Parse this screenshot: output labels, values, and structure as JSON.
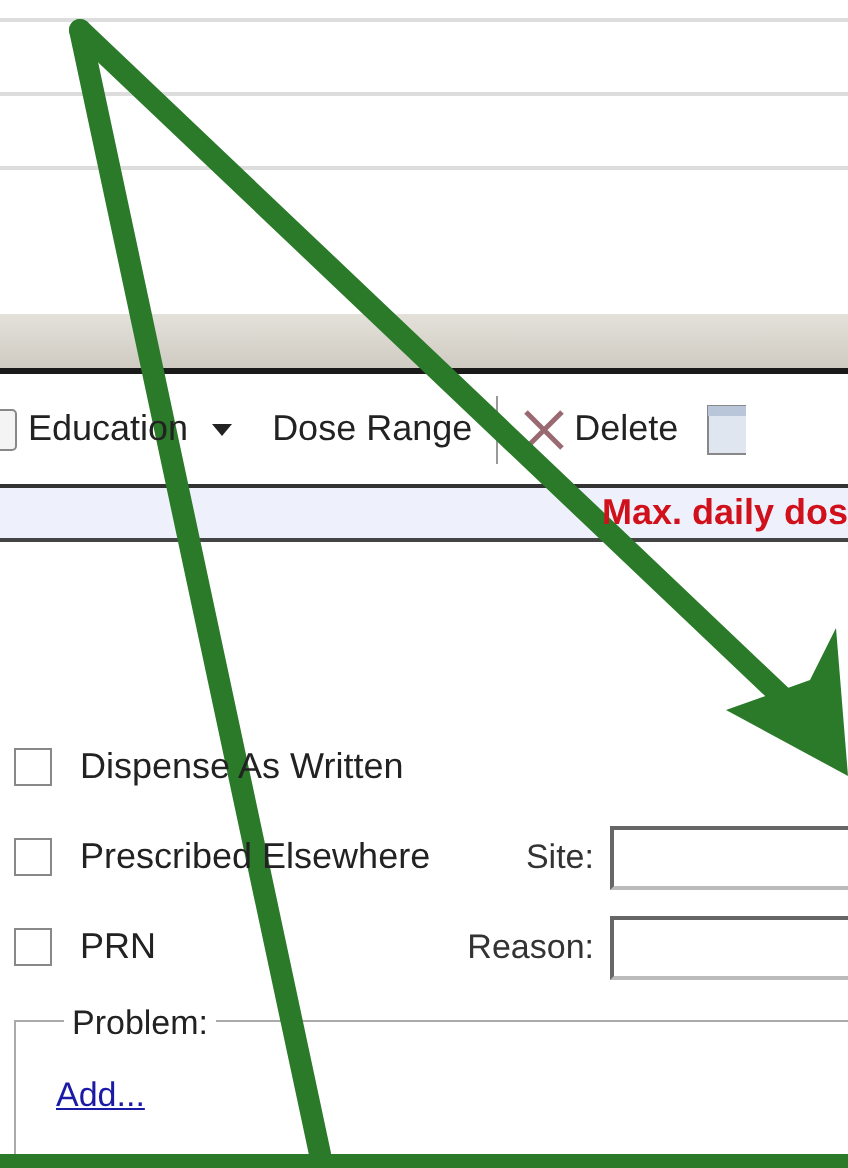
{
  "toolbar": [
    {
      "kind": "menu",
      "label": "Education"
    },
    {
      "kind": "plain",
      "label": "Dose Range"
    },
    {
      "kind": "delete",
      "label": "Delete"
    }
  ],
  "warning": "Max. daily dos",
  "options": [
    {
      "label": "Dispense As Written",
      "checked": false
    },
    {
      "label": "Prescribed Elsewhere",
      "checked": false,
      "field_label": "Site:"
    },
    {
      "label": "PRN",
      "checked": false,
      "field_label": "Reason:"
    }
  ],
  "problem": {
    "title": "Problem:",
    "link": "Add..."
  }
}
